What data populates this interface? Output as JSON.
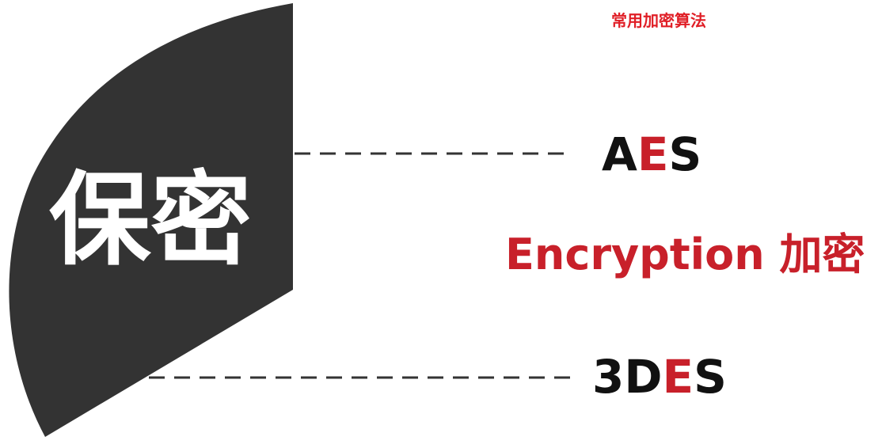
{
  "header": {
    "title": "常用加密算法"
  },
  "center": {
    "label": "保密"
  },
  "branches": [
    {
      "segments": [
        {
          "text": "A",
          "color": "#111111"
        },
        {
          "text": "E",
          "color": "#c8202a"
        },
        {
          "text": "S",
          "color": "#111111"
        }
      ]
    },
    {
      "segments": [
        {
          "text": "3D",
          "color": "#111111"
        },
        {
          "text": "E",
          "color": "#c8202a"
        },
        {
          "text": "S",
          "color": "#111111"
        }
      ]
    }
  ],
  "category": {
    "label": "Encryption 加密"
  },
  "colors": {
    "accent": "#c8202a",
    "shape": "#333333",
    "text_dark": "#111111",
    "dash_line": "#333333"
  }
}
